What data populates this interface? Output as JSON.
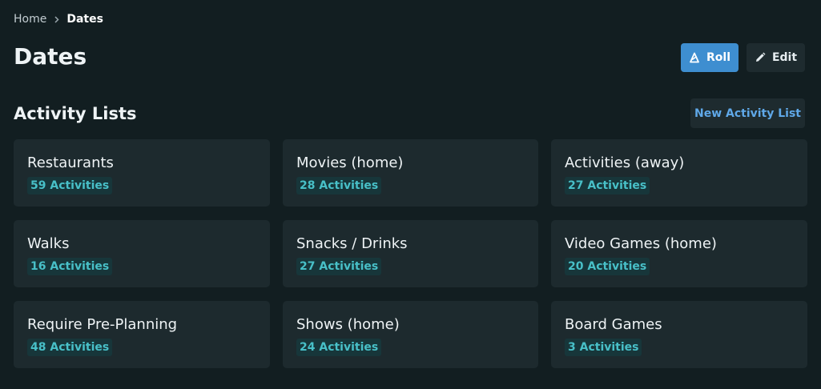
{
  "breadcrumb": {
    "home": "Home",
    "current": "Dates"
  },
  "page": {
    "title": "Dates"
  },
  "actions": {
    "roll_label": "Roll",
    "edit_label": "Edit"
  },
  "section": {
    "title": "Activity Lists",
    "new_label": "New Activity List"
  },
  "lists": [
    {
      "name": "Restaurants",
      "count": "59 Activities"
    },
    {
      "name": "Movies (home)",
      "count": "28 Activities"
    },
    {
      "name": "Activities (away)",
      "count": "27 Activities"
    },
    {
      "name": "Walks",
      "count": "16 Activities"
    },
    {
      "name": "Snacks / Drinks",
      "count": "27 Activities"
    },
    {
      "name": "Video Games (home)",
      "count": "20 Activities"
    },
    {
      "name": "Require Pre-Planning",
      "count": "48 Activities"
    },
    {
      "name": "Shows (home)",
      "count": "24 Activities"
    },
    {
      "name": "Board Games",
      "count": "3 Activities"
    }
  ],
  "icons": {
    "separator": "chevron-right-icon",
    "roll": "dice-icon",
    "edit": "pencil-icon"
  },
  "colors": {
    "background": "#121e21",
    "primary": "#3e8ed0",
    "card": "#1d2a2e",
    "badge_text": "#48c0c8",
    "link": "#5fa8e8"
  }
}
